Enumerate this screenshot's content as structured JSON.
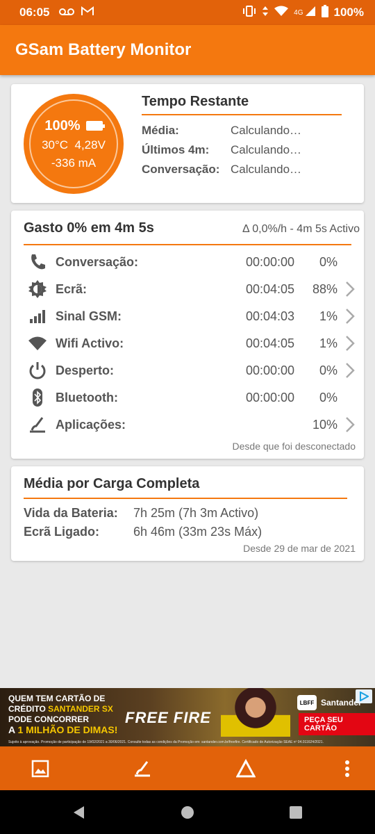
{
  "status_bar": {
    "time": "06:05",
    "network": "4G",
    "battery_percent": "100%",
    "icons": [
      "voicemail-icon",
      "gmail-icon",
      "vibrate-icon",
      "data-arrows-icon",
      "wifi-icon",
      "signal-icon",
      "battery-icon"
    ]
  },
  "app": {
    "title": "GSam Battery Monitor"
  },
  "summary": {
    "battery_percent": "100%",
    "temp_voltage": "30°C  4,28V",
    "current": "-336 mA",
    "title": "Tempo Restante",
    "rows": [
      {
        "label": "Média:",
        "value": "Calculando…"
      },
      {
        "label": "Últimos 4m:",
        "value": "Calculando…"
      },
      {
        "label": "Conversação:",
        "value": "Calculando…"
      }
    ]
  },
  "usage": {
    "title": "Gasto 0% em 4m 5s",
    "rate": "Δ 0,0%/h - 4m 5s Activo",
    "rows": [
      {
        "label": "Conversação:",
        "time": "00:00:00",
        "percent": "0%",
        "icon": "phone-icon",
        "has_chevron": false
      },
      {
        "label": "Ecrã:",
        "time": "00:04:05",
        "percent": "88%",
        "icon": "brightness-icon",
        "has_chevron": true
      },
      {
        "label": "Sinal GSM:",
        "time": "00:04:03",
        "percent": "1%",
        "icon": "signal-bars-icon",
        "has_chevron": true
      },
      {
        "label": "Wifi Activo:",
        "time": "00:04:05",
        "percent": "1%",
        "icon": "wifi-icon",
        "has_chevron": true
      },
      {
        "label": "Desperto:",
        "time": "00:00:00",
        "percent": "0%",
        "icon": "power-icon",
        "has_chevron": true
      },
      {
        "label": "Bluetooth:",
        "time": "00:00:00",
        "percent": "0%",
        "icon": "bluetooth-icon",
        "has_chevron": false
      },
      {
        "label": "Aplicações:",
        "time": "",
        "percent": "10%",
        "icon": "apps-gauge-icon",
        "has_chevron": true
      }
    ],
    "footer": "Desde que foi desconectado"
  },
  "average": {
    "title": "Média por Carga Completa",
    "rows": [
      {
        "label": "Vida da Bateria:",
        "value": "7h 25m (7h 3m Activo)"
      },
      {
        "label": "Ecrã Ligado:",
        "value": "6h 46m (33m 23s Máx)"
      }
    ],
    "footer": "Desde 29 de mar de 2021"
  },
  "ad": {
    "line1": "QUEM TEM CARTÃO DE",
    "line2a": "CRÉDITO ",
    "line2b": "SANTANDER SX",
    "line3": "PODE CONCORRER",
    "line4a": "A ",
    "line4b": "1 MILHÃO DE DIMAS!",
    "game": "FREE FIRE",
    "league": "LBFF",
    "brand": "Santander",
    "cta": "PEÇA SEU CARTÃO",
    "legal": "Sujeito à aprovação. Promoção de participação de 19/02/2021 a 30/06/2021. Consulte todas as condições da Promoção em: santander.com.br/freefire. Certificado de Autorização SEAE nº 04.011624/2021."
  },
  "bottom_bar": {
    "buttons": [
      "image-icon",
      "gauge-icon",
      "delta-icon",
      "more-vert-icon"
    ]
  },
  "nav_bar": {
    "buttons": [
      "back-icon",
      "home-icon",
      "recents-icon"
    ]
  },
  "colors": {
    "primary": "#f4780f",
    "primary_dark": "#e2620a",
    "background": "#e9e9e9"
  }
}
